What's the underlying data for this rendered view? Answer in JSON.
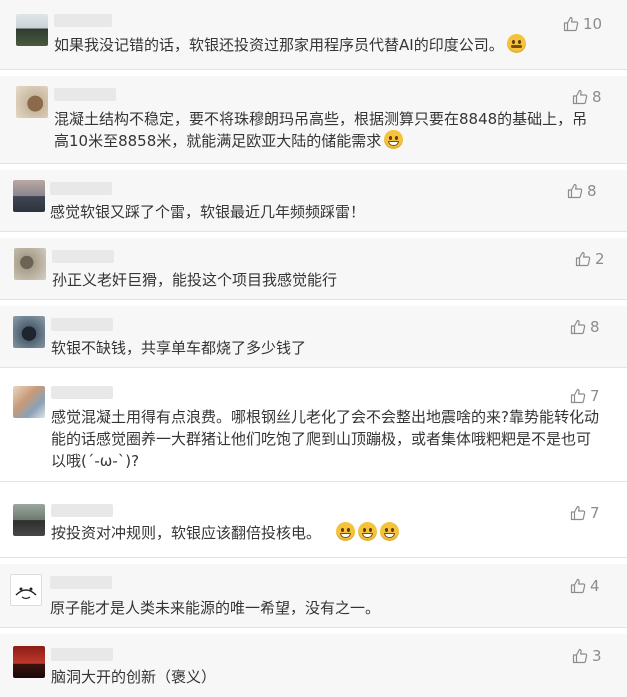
{
  "comments": [
    {
      "likes": "10",
      "text": "如果我没记错的话，软银还投资过那家用程序员代替AI的印度公司。",
      "emoji": "sly"
    },
    {
      "likes": "8",
      "text": "混凝土结构不稳定，要不将珠穆朗玛吊高些，根据测算只要在8848的基础上，吊高10米至8858米，就能满足欧亚大陆的储能需求",
      "emoji": "grin"
    },
    {
      "likes": "8",
      "text": "感觉软银又踩了个雷，软银最近几年频频踩雷！",
      "emoji": ""
    },
    {
      "likes": "2",
      "text": "孙正义老奸巨猾，能投这个项目我感觉能行",
      "emoji": ""
    },
    {
      "likes": "8",
      "text": "软银不缺钱，共享单车都烧了多少钱了",
      "emoji": ""
    },
    {
      "likes": "7",
      "text": "感觉混凝土用得有点浪费。哪根钢丝儿老化了会不会整出地震啥的来?靠势能转化动能的话感觉圈养一大群猪让他们吃饱了爬到山顶蹦极，或者集体哦粑粑是不是也可以哦(´-ω-`)?",
      "emoji": ""
    },
    {
      "likes": "7",
      "text": "按投资对冲规则，软银应该翻倍投核电。",
      "emoji": "grin3"
    },
    {
      "likes": "4",
      "text": "原子能才是人类未来能源的唯一希望，没有之一。",
      "emoji": ""
    },
    {
      "likes": "3",
      "text": "脑洞大开的创新（褒义）",
      "emoji": ""
    }
  ],
  "icons": {
    "like": "thumbs-up-icon"
  },
  "colors": {
    "card_bg": "#f7f7f7",
    "like_gray": "#8c8c8c",
    "emoji_yellow": "#f5c33b"
  }
}
